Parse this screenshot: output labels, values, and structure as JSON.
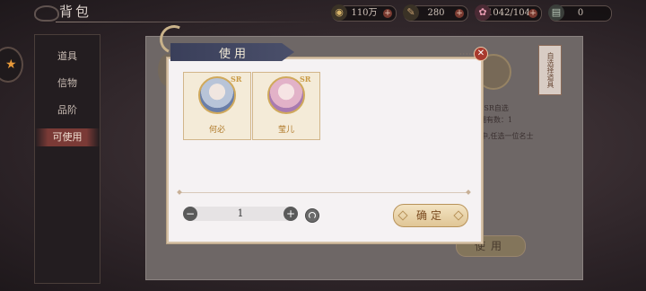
{
  "app": {
    "title": "背包"
  },
  "resources": [
    {
      "value": "110万",
      "icon": "coin-icon"
    },
    {
      "value": "280",
      "icon": "feather-icon"
    },
    {
      "value": "1042/104",
      "icon": "flower-icon"
    },
    {
      "value": "0",
      "icon": "scroll-icon"
    }
  ],
  "sidebar": {
    "items": [
      {
        "label": "道具"
      },
      {
        "label": "信物"
      },
      {
        "label": "品阶"
      },
      {
        "label": "可使用"
      }
    ]
  },
  "background_panel": {
    "ribbon": "自选择道具",
    "ssr_line": "SSR自选",
    "qty_line": "拥有数：1",
    "desc_line": "中,任选一位名士",
    "use_button": "使用"
  },
  "dialog": {
    "title": "使用",
    "cards": [
      {
        "name": "何必",
        "badge": "SR"
      },
      {
        "name": "莹儿",
        "badge": "SR"
      }
    ],
    "quantity": "1",
    "confirm_label": "确定"
  },
  "colors": {
    "accent": "#d0a95c",
    "header": "#3a3f5a",
    "close": "#a83a2e"
  }
}
